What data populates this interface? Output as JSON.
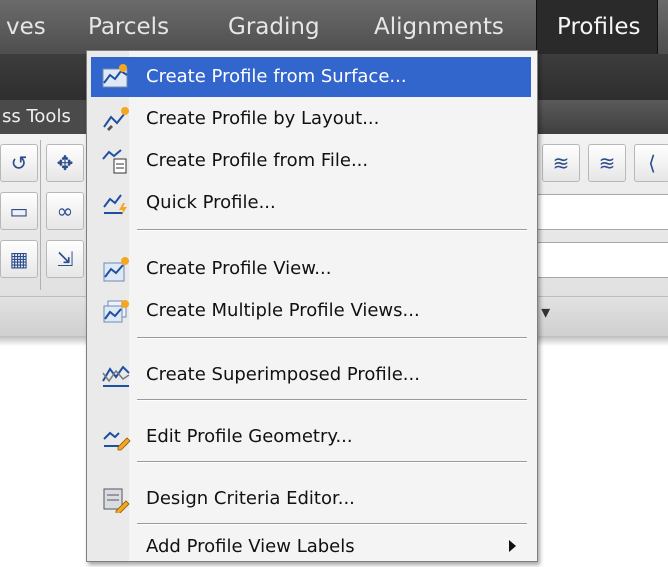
{
  "menubar": {
    "items": [
      {
        "label": "ves"
      },
      {
        "label": "Parcels"
      },
      {
        "label": "Grading"
      },
      {
        "label": "Alignments"
      },
      {
        "label": "Profiles"
      }
    ]
  },
  "ribbon": {
    "tab_label": "ss Tools",
    "panel_label": "s ▾"
  },
  "profiles_menu": {
    "items": [
      {
        "label": "Create Profile from Surface...",
        "icon": "surface-profile-icon"
      },
      {
        "label": "Create Profile by Layout...",
        "icon": "layout-profile-icon"
      },
      {
        "label": "Create Profile from File...",
        "icon": "file-profile-icon"
      },
      {
        "label": "Quick Profile...",
        "icon": "quick-profile-icon"
      },
      {
        "label": "Create Profile View...",
        "icon": "profile-view-icon"
      },
      {
        "label": "Create Multiple Profile Views...",
        "icon": "multiple-profile-views-icon"
      },
      {
        "label": "Create Superimposed Profile...",
        "icon": "superimposed-profile-icon"
      },
      {
        "label": "Edit Profile Geometry...",
        "icon": "edit-geometry-icon"
      },
      {
        "label": "Design Criteria Editor...",
        "icon": "design-criteria-icon"
      },
      {
        "label": "Add Profile View Labels",
        "icon": "none"
      }
    ]
  },
  "colors": {
    "highlight": "#3266cc",
    "menubar": "#5a5a5a"
  }
}
